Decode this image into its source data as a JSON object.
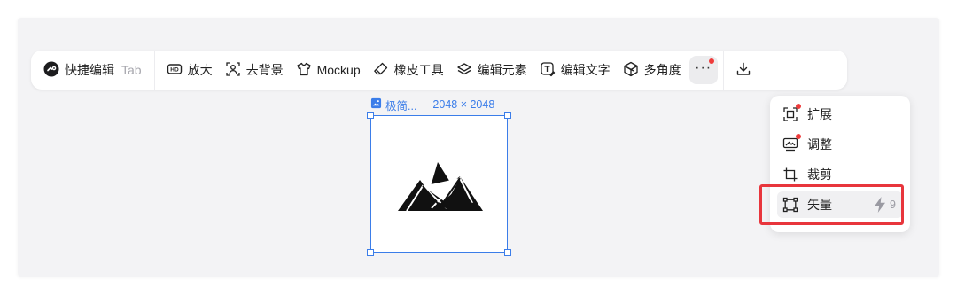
{
  "toolbar": {
    "quick_edit": {
      "label": "快捷编辑",
      "shortcut": "Tab",
      "icon": "quick-edit-icon"
    },
    "items": [
      {
        "label": "放大",
        "icon": "hd-icon"
      },
      {
        "label": "去背景",
        "icon": "remove-bg-icon"
      },
      {
        "label": "Mockup",
        "icon": "tshirt-icon"
      },
      {
        "label": "橡皮工具",
        "icon": "eraser-icon"
      },
      {
        "label": "编辑元素",
        "icon": "layers-icon"
      },
      {
        "label": "编辑文字",
        "icon": "text-edit-icon"
      },
      {
        "label": "多角度",
        "icon": "cube-icon"
      }
    ],
    "more_label": "···"
  },
  "selection": {
    "name": "极简...",
    "dimensions": "2048 × 2048"
  },
  "menu": {
    "items": [
      {
        "label": "扩展",
        "icon": "expand-icon",
        "badge": true
      },
      {
        "label": "调整",
        "icon": "adjust-icon",
        "badge": true
      },
      {
        "label": "裁剪",
        "icon": "crop-icon",
        "badge": false
      },
      {
        "label": "矢量",
        "icon": "vector-icon",
        "badge": false,
        "credit": "9",
        "highlighted": true
      }
    ]
  },
  "colors": {
    "accent_blue": "#3b7de9",
    "notification_red": "#ef3b3b",
    "highlight_red": "#e8353c"
  }
}
